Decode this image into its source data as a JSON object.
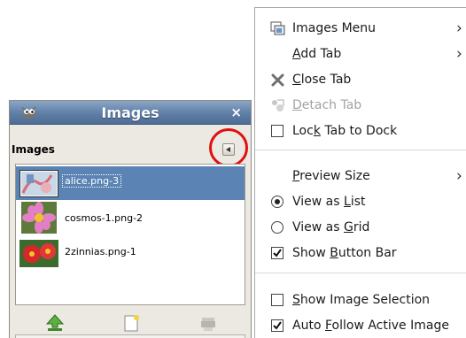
{
  "panel": {
    "title": "Images",
    "close_glyph": "×",
    "tab_label": "Images",
    "items": [
      {
        "name": "alice.png-3",
        "selected": true
      },
      {
        "name": "cosmos-1.png-2",
        "selected": false
      },
      {
        "name": "2zinnias.png-1",
        "selected": false
      }
    ],
    "buttons": [
      "raise-image-icon",
      "new-image-icon",
      "delete-image-icon"
    ]
  },
  "menu": {
    "items": [
      {
        "pre": "",
        "key": "",
        "post": "Images Menu",
        "icon": "images-menu-icon",
        "submenu": true
      },
      {
        "pre": "",
        "key": "A",
        "post": "dd Tab",
        "submenu": true
      },
      {
        "pre": "",
        "key": "C",
        "post": "lose Tab",
        "icon": "close-tab-icon"
      },
      {
        "pre": "",
        "key": "D",
        "post": "etach Tab",
        "icon": "detach-tab-icon",
        "disabled": true
      },
      {
        "pre": "Loc",
        "key": "k",
        "post": " Tab to Dock",
        "check": false
      },
      {
        "pre": "",
        "key": "P",
        "post": "review Size",
        "submenu": true
      },
      {
        "pre": "View as ",
        "key": "L",
        "post": "ist",
        "radio": true
      },
      {
        "pre": "View as ",
        "key": "G",
        "post": "rid",
        "radio": false
      },
      {
        "pre": "Show ",
        "key": "B",
        "post": "utton Bar",
        "check": true
      },
      {
        "pre": "",
        "key": "S",
        "post": "how Image Selection",
        "check": false
      },
      {
        "pre": "Auto ",
        "key": "F",
        "post": "ollow Active Image",
        "check": true
      }
    ]
  },
  "colors": {
    "titlebar": "#5f7ea6",
    "selection": "#5b84b4",
    "highlight_ring": "#e01010"
  }
}
